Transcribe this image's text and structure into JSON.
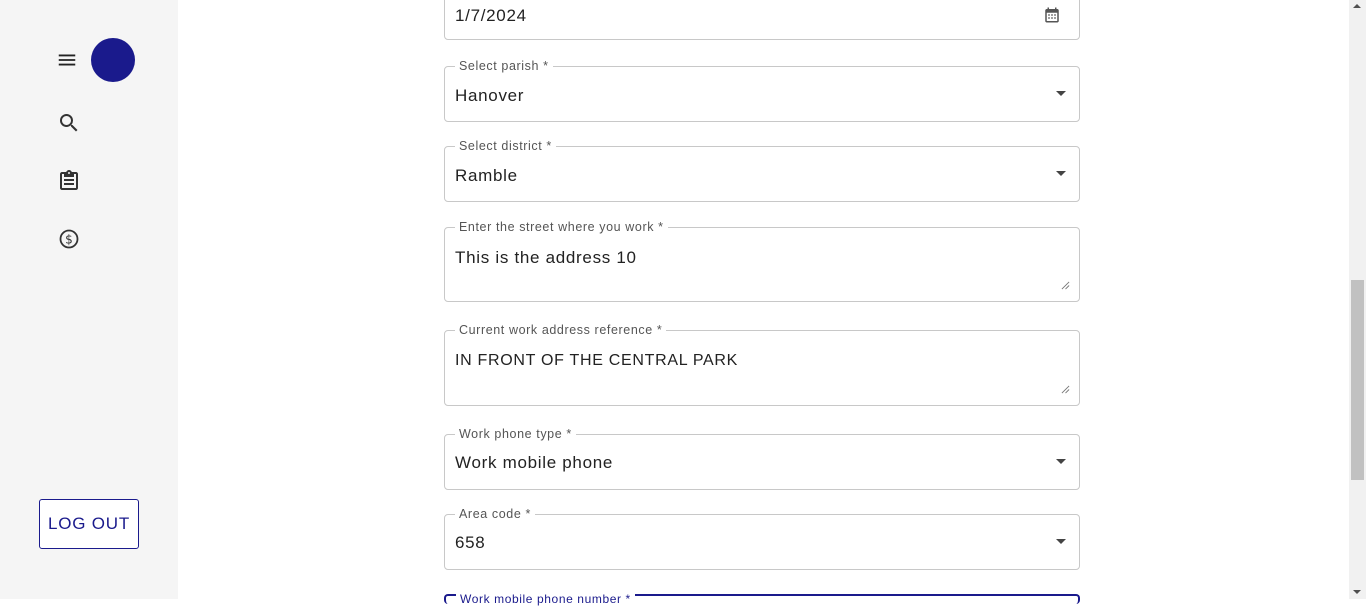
{
  "sidebar": {
    "menu_icon": "menu-icon",
    "avatar_color": "#1a1a8c",
    "nav": [
      {
        "icon": "search-icon"
      },
      {
        "icon": "clipboard-icon"
      },
      {
        "icon": "dollar-icon"
      }
    ],
    "logout_label": "LOG OUT"
  },
  "form": {
    "date": {
      "value": "1/7/2024",
      "icon": "calendar-icon"
    },
    "parish": {
      "label": "Select parish *",
      "value": "Hanover"
    },
    "district": {
      "label": "Select district *",
      "value": "Ramble"
    },
    "street": {
      "label": "Enter the street where you work *",
      "value": "This is the address 10"
    },
    "reference": {
      "label": "Current work address reference *",
      "value": "IN FRONT OF THE CENTRAL PARK"
    },
    "phone_type": {
      "label": "Work phone type *",
      "value": "Work mobile phone"
    },
    "area_code": {
      "label": "Area code *",
      "value": "658"
    },
    "mobile_number": {
      "label": "Work mobile phone number *",
      "value": ""
    }
  },
  "colors": {
    "accent": "#1a1a8c",
    "sidebar_bg": "#f5f5f5"
  }
}
